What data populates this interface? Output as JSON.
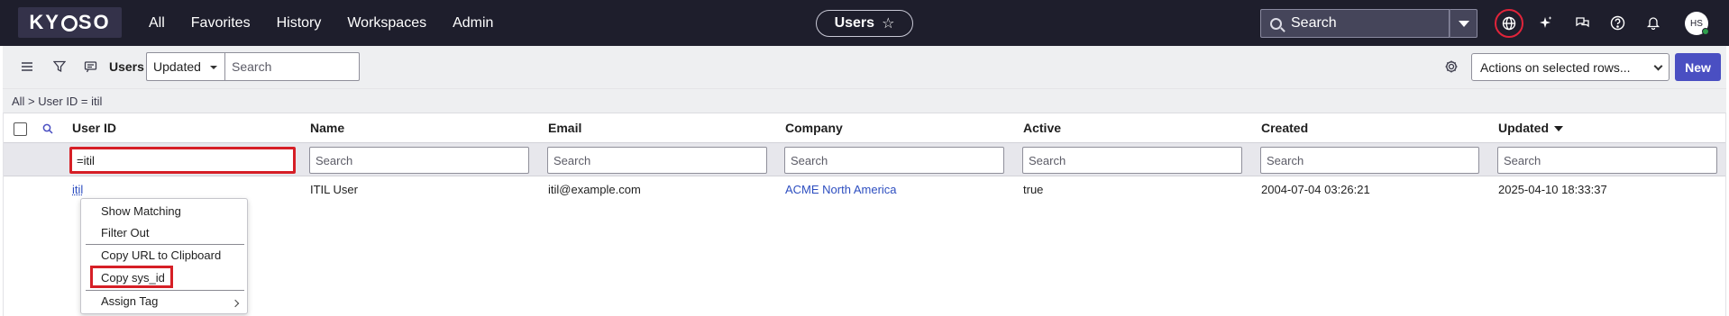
{
  "brand": {
    "logo_text": "KYOSO"
  },
  "nav": {
    "links": [
      "All",
      "Favorites",
      "History",
      "Workspaces",
      "Admin"
    ],
    "context_pill": "Users",
    "search_label": "Search"
  },
  "toolbar": {
    "title": "Users",
    "field_select": "Updated",
    "search_placeholder": "Search",
    "actions_select": "Actions on selected rows...",
    "new_label": "New"
  },
  "breadcrumb": {
    "text": "All > User ID = itil"
  },
  "table": {
    "columns": [
      "User ID",
      "Name",
      "Email",
      "Company",
      "Active",
      "Created",
      "Updated"
    ],
    "sort_column": "Updated",
    "filters": {
      "user_id": "=itil",
      "placeholder": "Search"
    },
    "rows": [
      {
        "user_id": "itil",
        "name": "ITIL User",
        "email": "itil@example.com",
        "company": "ACME North America",
        "active": "true",
        "created": "2004-07-04 03:26:21",
        "updated": "2025-04-10 18:33:37"
      }
    ]
  },
  "context_menu": {
    "items": [
      "Show Matching",
      "Filter Out",
      "Copy URL to Clipboard",
      "Copy sys_id",
      "Assign Tag"
    ],
    "highlighted": "Copy sys_id"
  },
  "user": {
    "initials": "HS"
  },
  "colors": {
    "nav_bg": "#1e1e2c",
    "accent": "#4a4fc2",
    "link": "#2d4ec0",
    "highlight": "#d61f26"
  }
}
